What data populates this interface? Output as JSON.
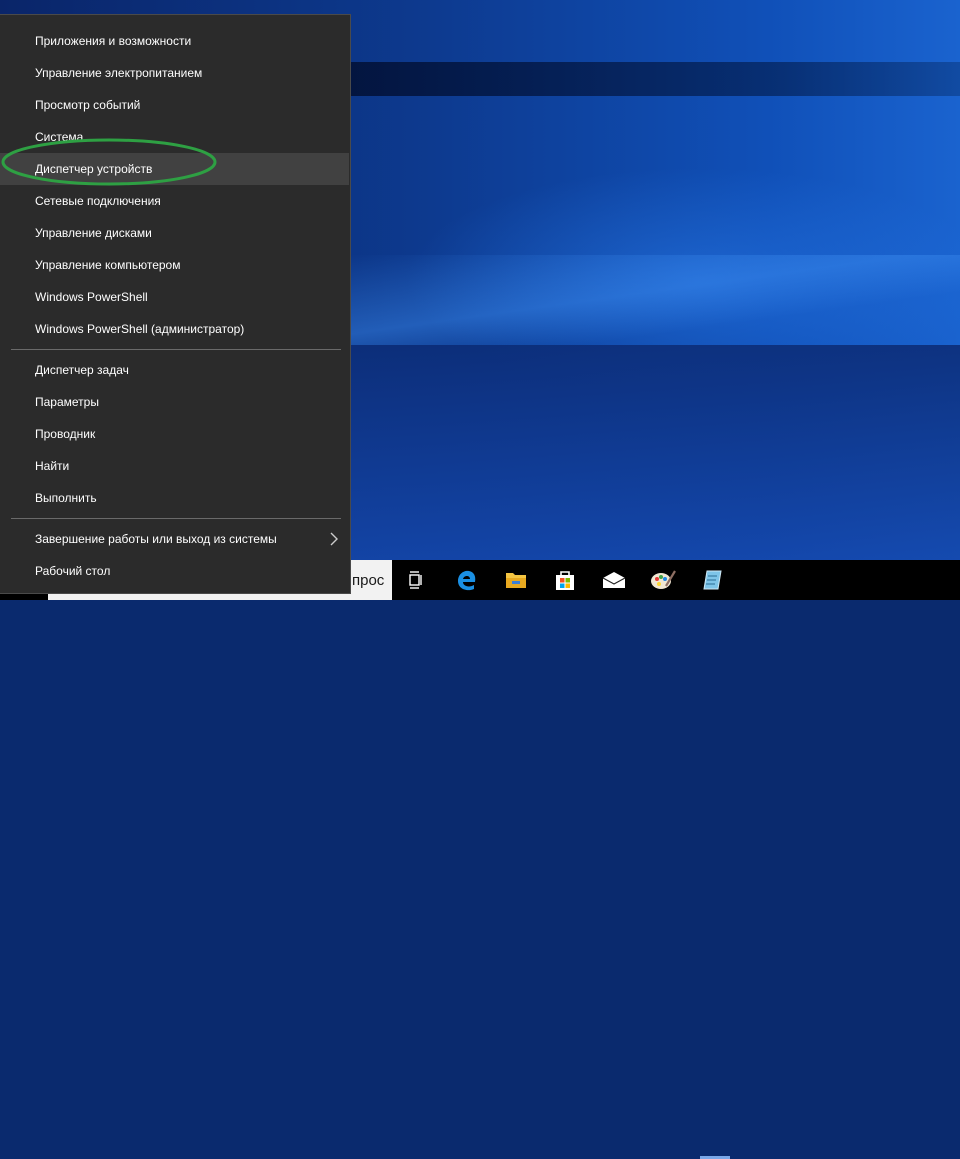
{
  "menu": {
    "items": [
      {
        "label": "Приложения и возможности"
      },
      {
        "label": "Управление электропитанием"
      },
      {
        "label": "Просмотр событий"
      },
      {
        "label": "Система"
      },
      {
        "label": "Диспетчер устройств"
      },
      {
        "label": "Сетевые подключения"
      },
      {
        "label": "Управление дисками"
      },
      {
        "label": "Управление компьютером"
      },
      {
        "label": "Windows PowerShell"
      },
      {
        "label": "Windows PowerShell (администратор)"
      },
      {
        "label": "Диспетчер задач"
      },
      {
        "label": "Параметры"
      },
      {
        "label": "Проводник"
      },
      {
        "label": "Найти"
      },
      {
        "label": "Выполнить"
      },
      {
        "label": "Завершение работы или выход из системы"
      },
      {
        "label": "Рабочий стол"
      }
    ],
    "highlighted_item": "Диспетчер устройств",
    "highlight_color": "#2ea043"
  },
  "taskbar": {
    "search_text": "прос",
    "icons": [
      {
        "name": "task-view-icon"
      },
      {
        "name": "edge-icon",
        "color": "#1a8fe3"
      },
      {
        "name": "file-explorer-icon",
        "color": "#f4c542"
      },
      {
        "name": "store-icon"
      },
      {
        "name": "mail-icon"
      },
      {
        "name": "paint-icon"
      },
      {
        "name": "notepad-icon",
        "color": "#7ec4e8"
      }
    ]
  }
}
